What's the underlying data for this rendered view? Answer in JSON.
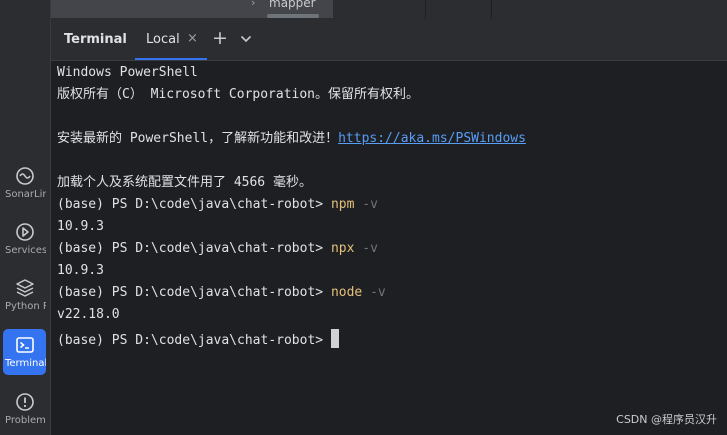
{
  "tree": {
    "item_label": "mapper"
  },
  "sidebar": {
    "items": [
      {
        "label": "SonarLint",
        "icon": "sonarlint-icon",
        "active": false
      },
      {
        "label": "Services",
        "icon": "services-icon",
        "active": false
      },
      {
        "label": "Python Packages",
        "icon": "python-packages-icon",
        "active": false
      },
      {
        "label": "Terminal",
        "icon": "terminal-icon",
        "active": true
      },
      {
        "label": "Problems",
        "icon": "problems-icon",
        "active": false
      }
    ]
  },
  "panel": {
    "title": "Terminal",
    "tabs": [
      {
        "label": "Local",
        "active": true
      }
    ],
    "close_glyph": "×",
    "add_glyph": "+"
  },
  "terminal": {
    "lines": {
      "l1": "Windows PowerShell",
      "l2": "版权所有（C） Microsoft Corporation。保留所有权利。",
      "l3_prefix": "安装最新的 PowerShell，了解新功能和改进！",
      "l3_link": "https://aka.ms/PSWindows",
      "l4": "加载个人及系统配置文件用了 4566 毫秒。",
      "prompt": "(base) PS D:\\code\\java\\chat-robot> ",
      "c1_cmd": "npm",
      "c1_flag": " -v",
      "o1": "10.9.3",
      "c2_cmd": "npx",
      "c2_flag": " -v",
      "o2": "10.9.3",
      "c3_cmd": "node",
      "c3_flag": " -v",
      "o3": "v22.18.0"
    }
  },
  "watermark": "CSDN @程序员汉升",
  "colors": {
    "accent": "#3574f0",
    "command": "#e5c07b",
    "link": "#589df6",
    "background": "#1e1f22"
  }
}
